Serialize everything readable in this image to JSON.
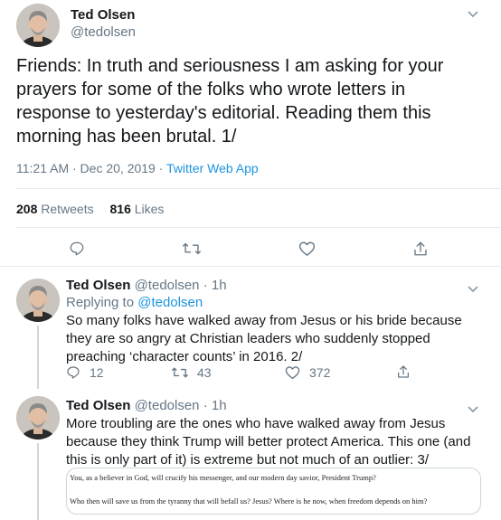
{
  "main_tweet": {
    "author_name": "Ted Olsen",
    "author_handle": "@tedolsen",
    "text": "Friends: In truth and seriousness I am asking for your prayers for some of the folks who wrote letters in response to yesterday's editorial. Reading them this morning has been brutal. 1/",
    "timestamp": "11:21 AM · Dec 20, 2019 · ",
    "source": "Twitter Web App",
    "retweets_count": "208",
    "retweets_label": "Retweets",
    "likes_count": "816",
    "likes_label": "Likes"
  },
  "reply1": {
    "author_name": "Ted Olsen",
    "author_handle": "@tedolsen",
    "time": "· 1h",
    "replying_prefix": "Replying to ",
    "replying_handle": "@tedolsen",
    "text": "So many folks have walked away from Jesus or his bride because they are so angry at Christian leaders who suddenly stopped preaching ‘character counts’ in 2016. 2/",
    "reply_count": "12",
    "retweet_count": "43",
    "like_count": "372"
  },
  "reply2": {
    "author_name": "Ted Olsen",
    "author_handle": "@tedolsen",
    "time": "· 1h",
    "text": "More troubling are the ones who have walked away from Jesus because they think Trump will better protect America. This one (and this is only part of it) is extreme but not much of an outlier: 3/",
    "quote_line1": "You, as a believer in God, will crucify his messenger, and our modern day savior, President Trump?",
    "quote_line2": "Who then will save us from the tyranny that will befall us?  Jesus?  Where is he now, when freedom depends on him?"
  },
  "colors": {
    "link": "#1b95e0",
    "muted": "#657786",
    "divider": "#e6ecf0"
  },
  "icons": [
    "chevron-down-icon",
    "reply-icon",
    "retweet-icon",
    "like-icon",
    "share-icon"
  ]
}
